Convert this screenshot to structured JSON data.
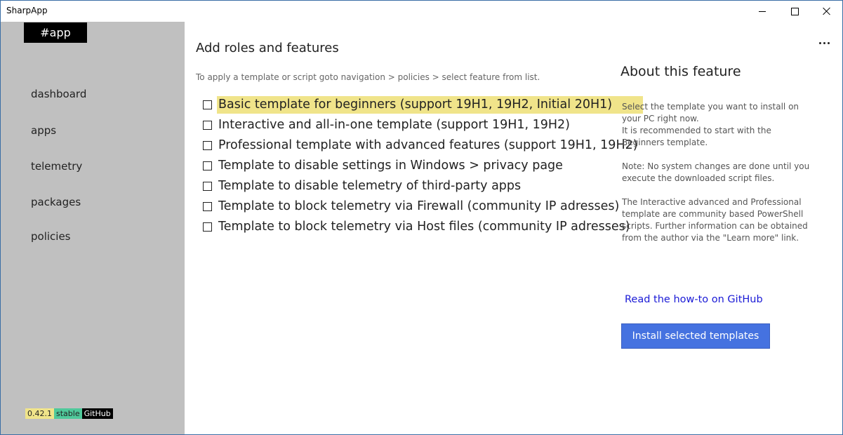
{
  "window": {
    "title": "SharpApp"
  },
  "sidebar": {
    "logo": "#app",
    "items": [
      {
        "label": "dashboard"
      },
      {
        "label": "apps"
      },
      {
        "label": "telemetry"
      },
      {
        "label": "packages"
      },
      {
        "label": "policies"
      }
    ],
    "badges": {
      "version": "0.42.1",
      "channel": "stable",
      "github": "GitHub"
    }
  },
  "main": {
    "title": "Add roles and features",
    "hint": "To apply a template or script goto navigation > policies > select feature from list.",
    "features": [
      {
        "label": "Basic template for beginners (support 19H1, 19H2, Initial 20H1)",
        "checked": false,
        "highlighted": true
      },
      {
        "label": "Interactive and all-in-one template (support 19H1, 19H2)",
        "checked": false,
        "highlighted": false
      },
      {
        "label": "Professional template with advanced features (support 19H1, 19H2)",
        "checked": false,
        "highlighted": false
      },
      {
        "label": "Template to disable settings in Windows > privacy page",
        "checked": false,
        "highlighted": false
      },
      {
        "label": "Template to disable telemetry of third-party apps",
        "checked": false,
        "highlighted": false
      },
      {
        "label": "Template to block telemetry via Firewall (community IP adresses)",
        "checked": false,
        "highlighted": false
      },
      {
        "label": "Template to block telemetry via Host files (community IP adresses)",
        "checked": false,
        "highlighted": false
      }
    ]
  },
  "about": {
    "title": "About this feature",
    "paragraphs": [
      "Select the template you want to install on your PC right now.\nIt is recommended to start with the Beginners template.",
      "Note: No system changes are done until you execute the downloaded script files.",
      "The Interactive advanced and Professional template are community based PowerShell scripts. Further information can be obtained from the author via the \"Learn more\" link."
    ],
    "link": "Read the how-to on GitHub",
    "install_label": "Install selected templates"
  },
  "colors": {
    "sidebar_bg": "#c0c0c0",
    "highlight": "#f0e48a",
    "accent_button": "#4572e0",
    "link": "#1a1ad6"
  },
  "icons": [
    "minimize-icon",
    "maximize-icon",
    "close-icon",
    "more-options-icon",
    "checkbox-icon"
  ]
}
